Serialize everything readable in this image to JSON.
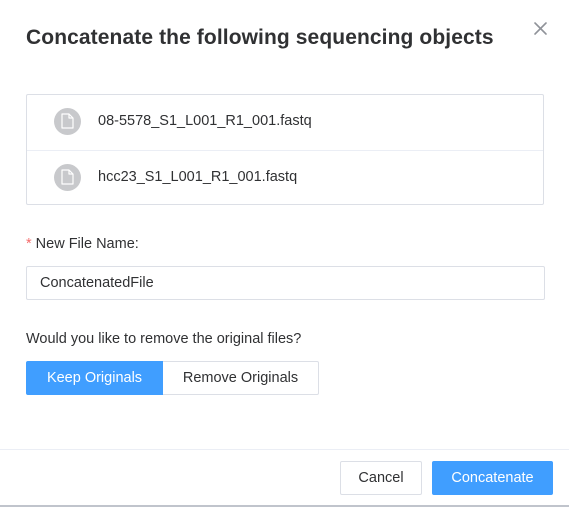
{
  "dialog": {
    "title": "Concatenate the following sequencing objects",
    "close_icon": "close-icon"
  },
  "files": [
    {
      "name": "08-5578_S1_L001_R1_001.fastq",
      "icon": "document-icon"
    },
    {
      "name": "hcc23_S1_L001_R1_001.fastq",
      "icon": "document-icon"
    }
  ],
  "new_file": {
    "required_mark": "*",
    "label": "New File Name:",
    "value": "ConcatenatedFile"
  },
  "remove_originals": {
    "question": "Would you like to remove the original files?",
    "options": [
      {
        "label": "Keep Originals",
        "selected": true
      },
      {
        "label": "Remove Originals",
        "selected": false
      }
    ]
  },
  "footer": {
    "cancel_label": "Cancel",
    "submit_label": "Concatenate"
  },
  "colors": {
    "primary": "#409eff",
    "required": "#f56c6c",
    "border": "#dcdfe6",
    "text": "#303133",
    "avatar": "#c8c9cc"
  }
}
